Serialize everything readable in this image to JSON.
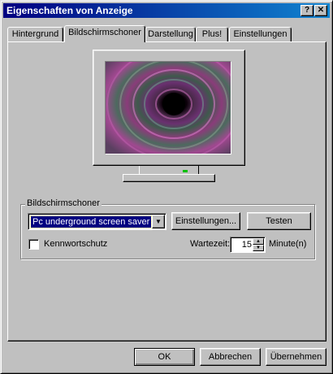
{
  "window": {
    "title": "Eigenschaften von Anzeige",
    "help_label": "?",
    "close_label": "✕"
  },
  "tabs": [
    {
      "label": "Hintergrund"
    },
    {
      "label": "Bildschirmschoner",
      "active": true
    },
    {
      "label": "Darstellung"
    },
    {
      "label": "Plus!"
    },
    {
      "label": "Einstellungen"
    }
  ],
  "screensaver": {
    "group_label": "Bildschirmschoner",
    "selected": "Pc underground screen saver",
    "settings_button": "Einstellungen...",
    "test_button": "Testen",
    "password_label": "Kennwortschutz",
    "password_checked": false,
    "wait_label": "Wartezeit:",
    "wait_value": "15",
    "minutes_label": "Minute(n)"
  },
  "footer": {
    "ok": "OK",
    "cancel": "Abbrechen",
    "apply": "Übernehmen"
  }
}
